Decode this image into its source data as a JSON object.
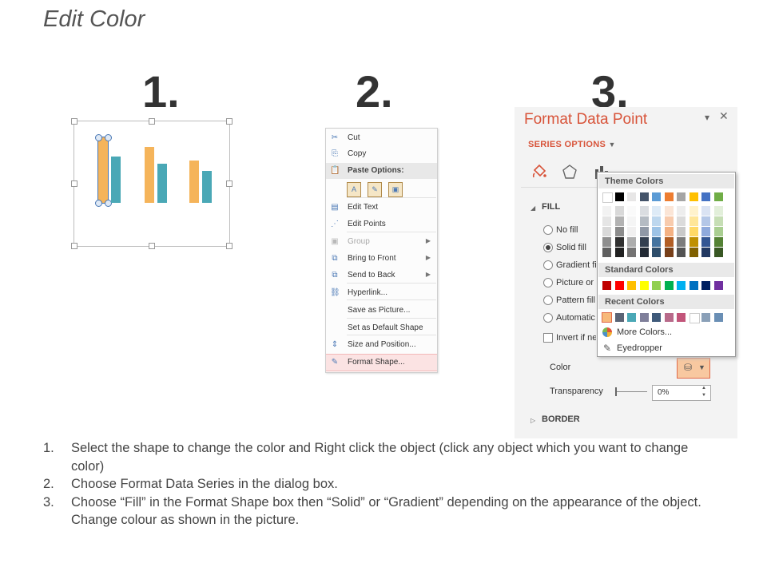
{
  "title": "Edit Color",
  "steps": [
    "1.",
    "2.",
    "3."
  ],
  "chart_data": {
    "type": "bar",
    "categories": [
      "",
      "",
      ""
    ],
    "series": [
      {
        "color": "#f5b45a",
        "values": [
          8.2,
          7.0,
          5.3
        ]
      },
      {
        "color": "#4aa8b6",
        "values": [
          5.8,
          4.9,
          4.0
        ]
      }
    ],
    "ylim": [
      0,
      9
    ],
    "grid": false,
    "legend": "none",
    "selected_point": {
      "series": 0,
      "category": 0
    }
  },
  "context_menu": {
    "items": [
      {
        "label": "Cut",
        "icon": "scissors-icon",
        "type": "item"
      },
      {
        "label": "Copy",
        "icon": "copy-icon",
        "type": "item"
      },
      {
        "label": "Paste Options:",
        "icon": "paste-icon",
        "type": "header"
      },
      {
        "label": "",
        "icon": "paste-icons",
        "type": "paste-row"
      },
      {
        "label": "Edit Text",
        "icon": "edit-text-icon",
        "type": "item"
      },
      {
        "label": "Edit Points",
        "icon": "edit-points-icon",
        "type": "item"
      },
      {
        "label": "Group",
        "icon": "group-icon",
        "type": "submenu",
        "disabled": true
      },
      {
        "label": "Bring to Front",
        "icon": "bring-front-icon",
        "type": "submenu"
      },
      {
        "label": "Send to Back",
        "icon": "send-back-icon",
        "type": "submenu"
      },
      {
        "label": "Hyperlink...",
        "icon": "hyperlink-icon",
        "type": "item"
      },
      {
        "label": "Save as Picture...",
        "icon": "",
        "type": "item"
      },
      {
        "label": "Set as Default Shape",
        "icon": "",
        "type": "item"
      },
      {
        "label": "Size and Position...",
        "icon": "size-position-icon",
        "type": "item"
      },
      {
        "label": "Format Shape...",
        "icon": "format-shape-icon",
        "type": "item",
        "highlighted": true
      }
    ]
  },
  "format_panel": {
    "title": "Format Data Point",
    "tab": "SERIES OPTIONS",
    "fill_section": "FILL",
    "fill_options": [
      {
        "label": "No fill",
        "selected": false
      },
      {
        "label": "Solid fill",
        "selected": true
      },
      {
        "label": "Gradient fill",
        "selected": false
      },
      {
        "label": "Picture or texture fill",
        "selected": false
      },
      {
        "label": "Pattern fill",
        "selected": false
      },
      {
        "label": "Automatic",
        "selected": false
      }
    ],
    "invert_label": "Invert if negative",
    "color_label": "Color",
    "transparency_label": "Transparency",
    "transparency_value": "0%",
    "border_section": "BORDER",
    "current_color": "#f8c8a0"
  },
  "palette": {
    "theme_header": "Theme Colors",
    "standard_header": "Standard Colors",
    "recent_header": "Recent Colors",
    "more_colors": "More Colors...",
    "eyedropper": "Eyedropper",
    "theme_colors": [
      "#ffffff",
      "#000000",
      "#e7e6e6",
      "#44546a",
      "#5b9bd5",
      "#ed7d31",
      "#a5a5a5",
      "#ffc000",
      "#4472c4",
      "#70ad47"
    ],
    "standard_colors": [
      "#c00000",
      "#ff0000",
      "#ffc000",
      "#ffff00",
      "#92d050",
      "#00b050",
      "#00b0f0",
      "#0070c0",
      "#002060",
      "#7030a0"
    ],
    "recent_colors": [
      "#f7b97a",
      "#5a6475",
      "#4aa8b6",
      "#7f7f9a",
      "#3f5a7a",
      "#b86a8a",
      "#c2557a",
      "#ffffff",
      "#8aa0b8",
      "#6a8fb5"
    ]
  },
  "instructions": [
    {
      "num": "1.",
      "text": "Select the shape to change the color and Right click the object (click any object which you want to change color)"
    },
    {
      "num": "2.",
      "text": "Choose Format Data Series in the dialog box."
    },
    {
      "num": "3.",
      "text": "Choose “Fill” in the Format Shape box then “Solid” or “Gradient” depending on the appearance of the object. Change colour as shown in the picture."
    }
  ]
}
